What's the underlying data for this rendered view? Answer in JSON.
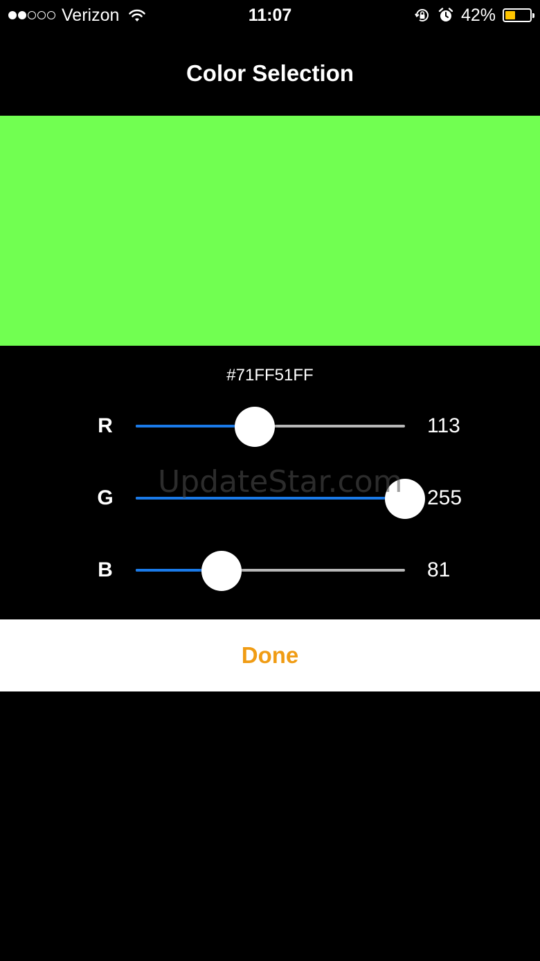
{
  "status_bar": {
    "carrier": "Verizon",
    "signal_bars": 2,
    "signal_total": 5,
    "time": "11:07",
    "battery_percent_text": "42%",
    "battery_level": 0.42,
    "battery_color": "#ffc500"
  },
  "nav": {
    "title": "Color Selection"
  },
  "preview": {
    "color": "#71FF51"
  },
  "hex_value": "#71FF51FF",
  "sliders": [
    {
      "label": "R",
      "value": "113",
      "fraction": 0.443,
      "fill_color": "#1a7ae8"
    },
    {
      "label": "G",
      "value": "255",
      "fraction": 1.0,
      "fill_color": "#1a7ae8"
    },
    {
      "label": "B",
      "value": "81",
      "fraction": 0.318,
      "fill_color": "#1a7ae8"
    }
  ],
  "watermark": "UpdateStar.com",
  "done_button": {
    "label": "Done",
    "color": "#f09c14"
  }
}
